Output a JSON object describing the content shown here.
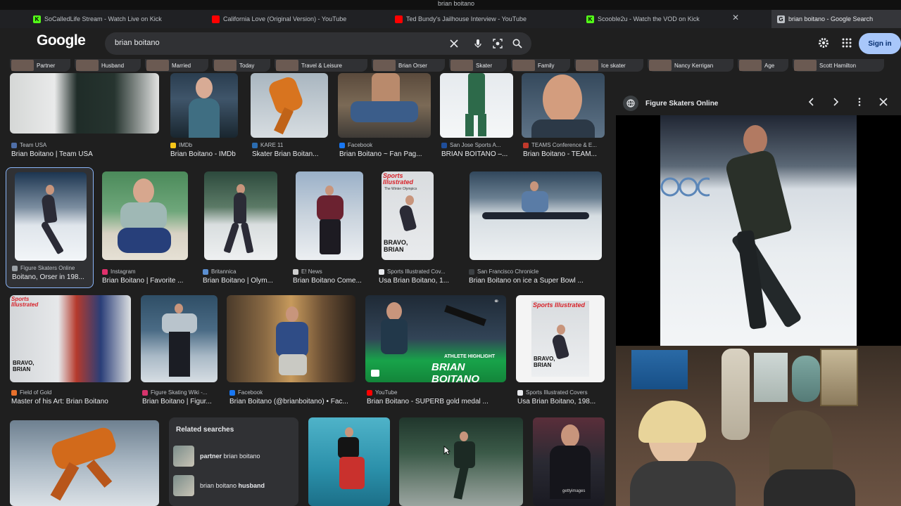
{
  "window": {
    "title": "brian boitano"
  },
  "tabs": [
    {
      "label": "SoCalledLife Stream - Watch Live on Kick",
      "icon": "kick-icon",
      "color": "#53fc18"
    },
    {
      "label": "California Love (Original Version) - YouTube",
      "icon": "youtube-icon",
      "color": "#ff0000"
    },
    {
      "label": "Ted Bundy's Jailhouse Interview - YouTube",
      "icon": "youtube-icon",
      "color": "#ff0000"
    },
    {
      "label": "Scooble2u - Watch the VOD on Kick",
      "icon": "kick-icon",
      "color": "#53fc18"
    },
    {
      "label": "brian boitano - Google Search",
      "icon": "google-icon",
      "color": "#bdc1c6"
    }
  ],
  "header": {
    "logo": "Google",
    "query": "brian boitano",
    "signin": "Sign in"
  },
  "chips": [
    "Partner",
    "Husband",
    "Married",
    "Today",
    "Travel & Leisure",
    "Brian Orser",
    "Skater",
    "Family",
    "Ice skater",
    "Nancy Kerrigan",
    "Age",
    "Scott Hamilton"
  ],
  "results": [
    {
      "source": "Team USA",
      "caption": "Brian Boitano | Team USA",
      "fav": "#4f6fa8"
    },
    {
      "source": "IMDb",
      "caption": "Brian Boitano - IMDb",
      "fav": "#f5c518"
    },
    {
      "source": "KARE 11",
      "caption": "Skater Brian Boitan...",
      "fav": "#2b6cb0"
    },
    {
      "source": "Facebook",
      "caption": "Brian Boitano ~ Fan Pag...",
      "fav": "#1877f2"
    },
    {
      "source": "San Jose Sports A...",
      "caption": "BRIAN BOITANO –...",
      "fav": "#1f4e9a"
    },
    {
      "source": "TEAMS Conference & E...",
      "caption": "Brian Boitano - TEAM...",
      "fav": "#c0392b"
    },
    {
      "source": "Figure Skaters Online",
      "caption": "Boitano, Orser in 198...",
      "fav": "#9aa0a6"
    },
    {
      "source": "Instagram",
      "caption": "Brian Boitano | Favorite ...",
      "fav": "#e1306c"
    },
    {
      "source": "Britannica",
      "caption": "Brian Boitano | Olym...",
      "fav": "#5b8fd1"
    },
    {
      "source": "E! News",
      "caption": "Brian Boitano Come...",
      "fav": "#cfcfcf"
    },
    {
      "source": "Sports Illustrated Cov...",
      "caption": "Usa Brian Boitano, 1...",
      "fav": "#e8eaed"
    },
    {
      "source": "San Francisco Chronicle",
      "caption": "Brian Boitano on ice a Super Bowl ...",
      "fav": "#3c4043"
    },
    {
      "source": "Field of Gold",
      "caption": "Master of his Art: Brian Boitano",
      "fav": "#e8712c"
    },
    {
      "source": "Figure Skating Wiki -...",
      "caption": "Brian Boitano | Figur...",
      "fav": "#d6336c"
    },
    {
      "source": "Facebook",
      "caption": "Brian Boitano (@brianboitano) • Fac...",
      "fav": "#1877f2"
    },
    {
      "source": "YouTube",
      "caption": "Brian Boitano - SUPERB gold medal ...",
      "fav": "#ff0000"
    },
    {
      "source": "Sports Illustrated Covers",
      "caption": "Usa Brian Boitano, 198...",
      "fav": "#e8eaed"
    }
  ],
  "related": {
    "title": "Related searches",
    "items": [
      {
        "bold": "partner",
        "rest": " brian boitano",
        "bold_first": true
      },
      {
        "bold": "husband",
        "rest": "brian boitano ",
        "bold_first": false
      }
    ]
  },
  "overlay_text": {
    "si_logo": "Sports Illustrated",
    "si_sub": "The Winter Olympics",
    "si_bravo": "BRAVO, BRIAN",
    "yt_banner": "BRIAN BOITANO",
    "yt_tag": "ATHLETE HIGHLIGHT",
    "getty": "gettyimages"
  },
  "panel": {
    "source": "Figure Skaters Online"
  }
}
